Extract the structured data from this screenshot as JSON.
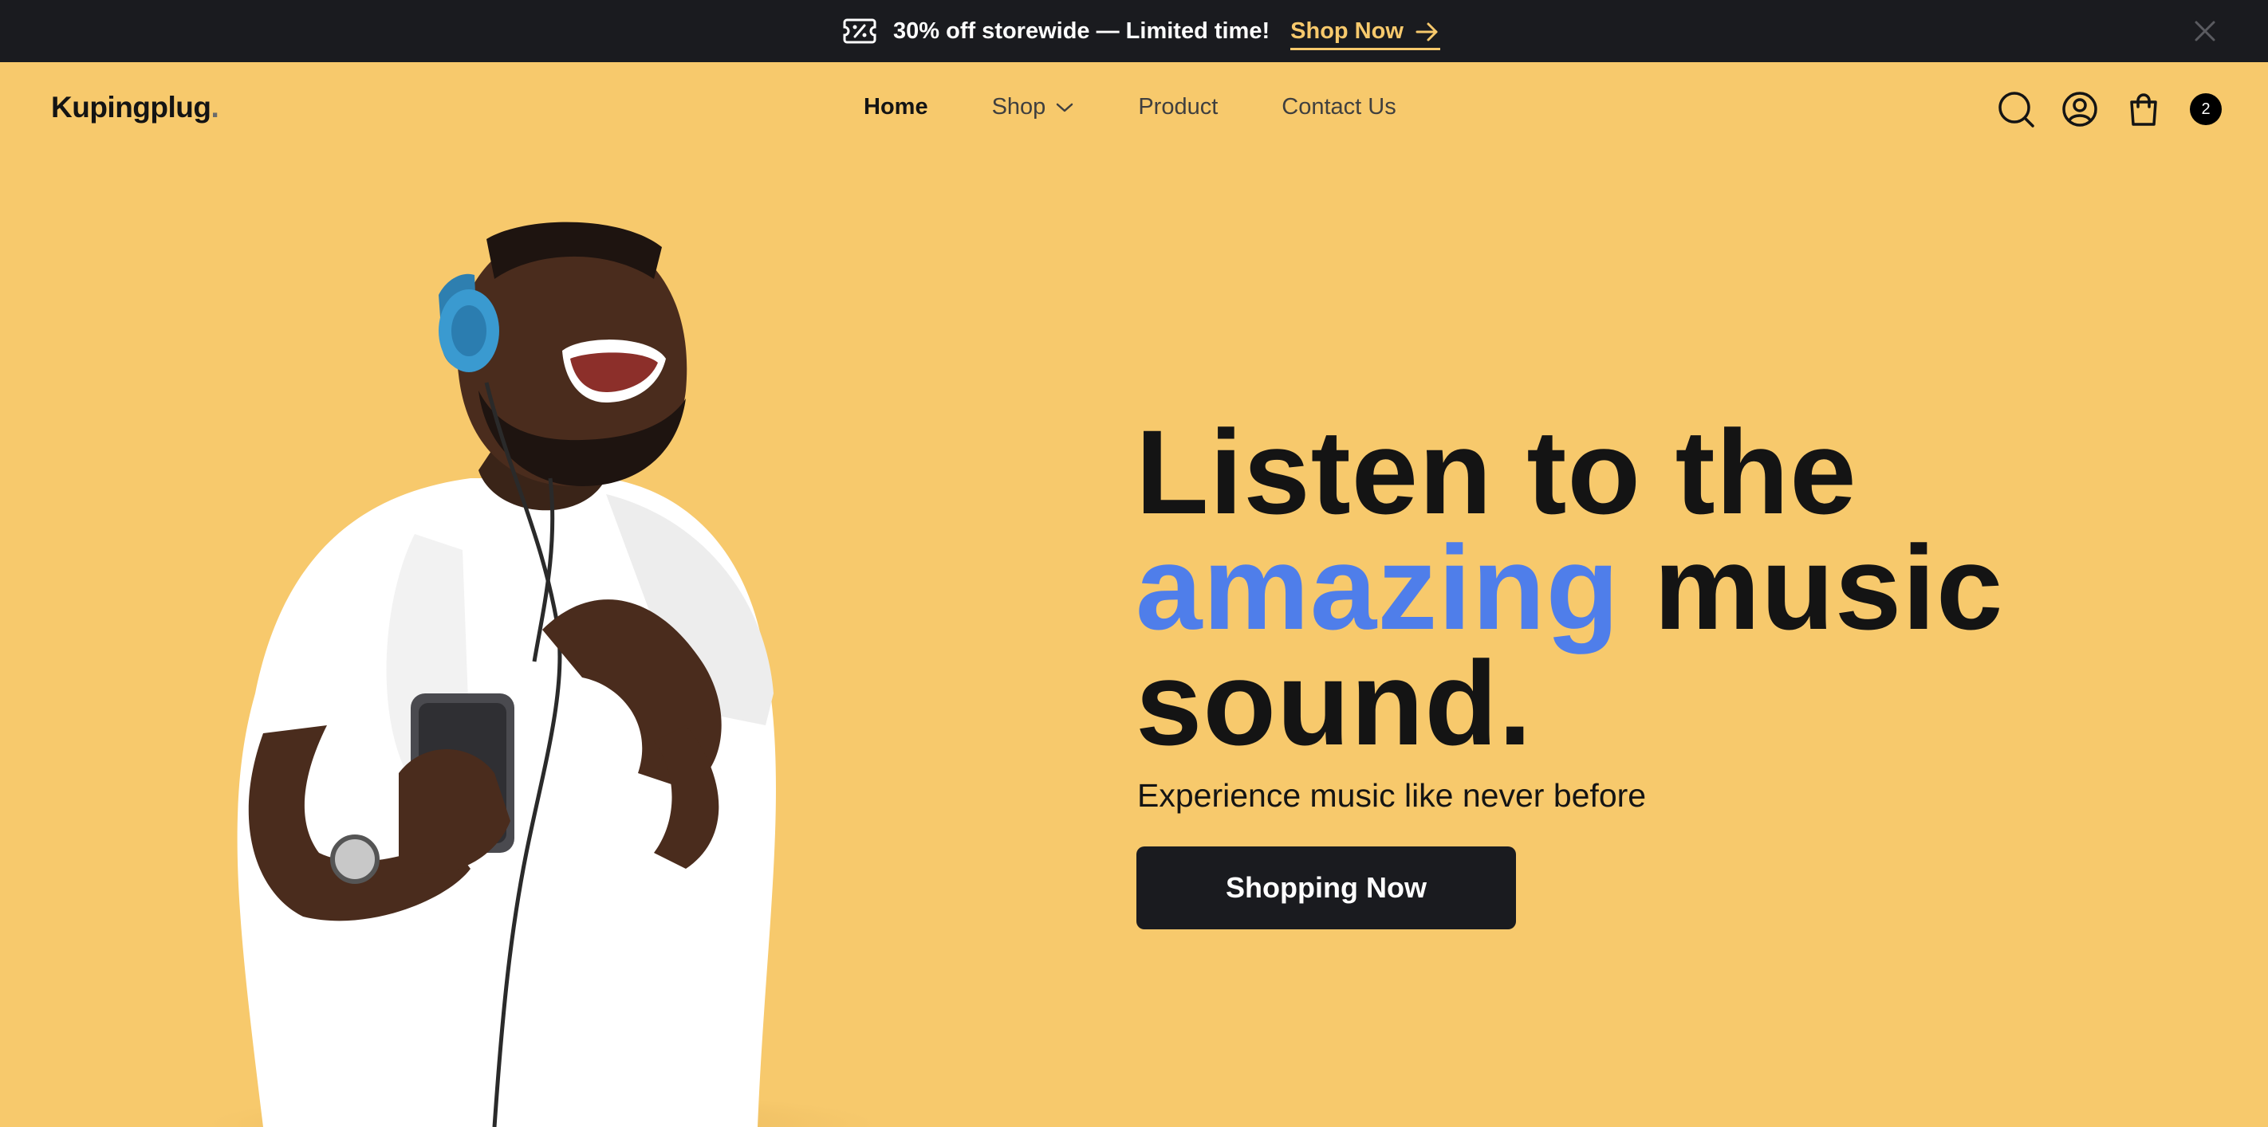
{
  "announcement": {
    "text": "30% off storewide — Limited time!",
    "link_label": "Shop Now"
  },
  "header": {
    "logo": "Kupingplug",
    "logo_suffix": ".",
    "nav": [
      "Home",
      "Shop",
      "Product",
      "Contact Us"
    ],
    "cart_count": "2"
  },
  "hero": {
    "headline_line1": "Listen to the",
    "headline_accent": "amazing",
    "headline_line2_rest": "music",
    "headline_line3": "sound.",
    "subtitle": "Experience music like never before",
    "cta_label": "Shopping Now"
  },
  "colors": {
    "background": "#F7C96C",
    "announcement_bg": "#1A1B1F",
    "accent": "#4F7EEA",
    "link": "#F7C96C"
  },
  "icons": [
    "discount-ticket-icon",
    "arrow-right-icon",
    "close-icon",
    "chevron-down-icon",
    "search-icon",
    "user-icon",
    "shopping-bag-icon"
  ]
}
